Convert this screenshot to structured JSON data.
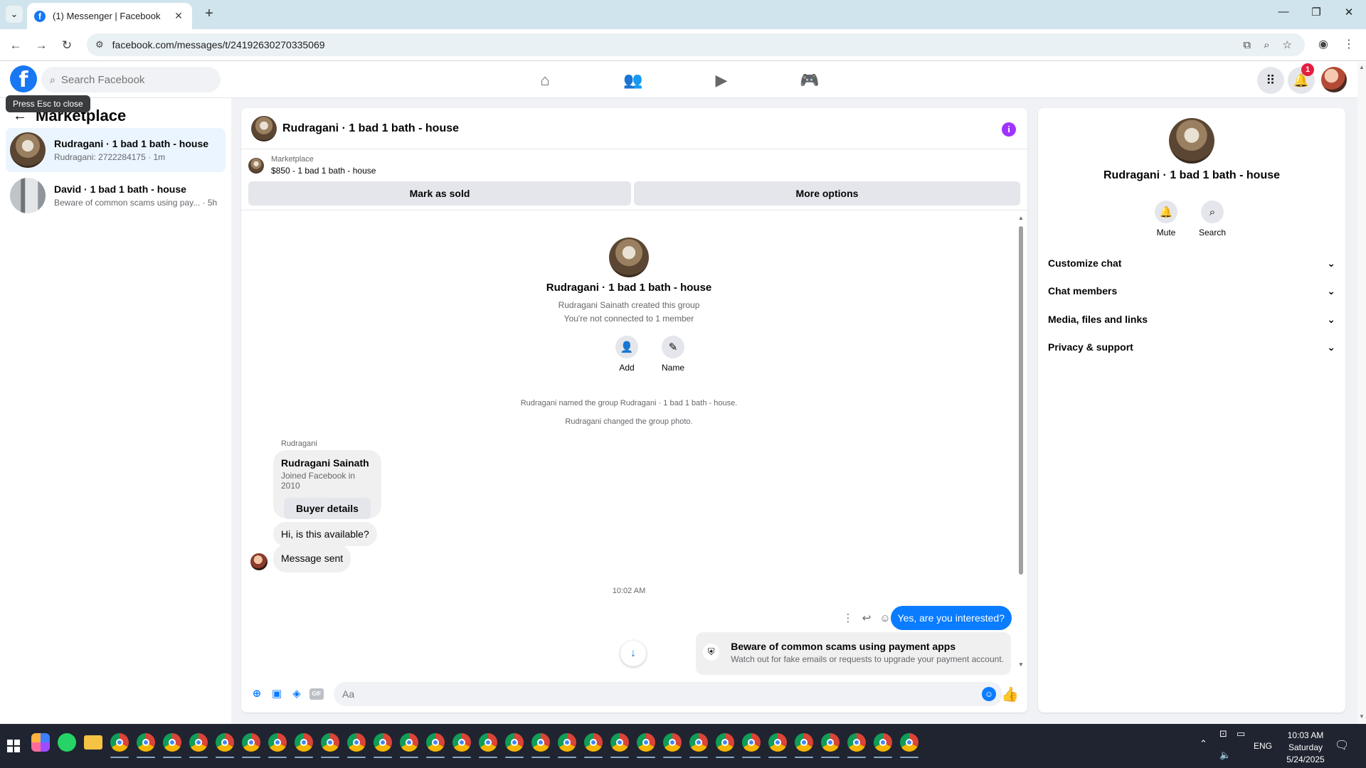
{
  "browser": {
    "tab_title": "(1) Messenger | Facebook",
    "favicon_letter": "f",
    "url": "facebook.com/messages/t/24192630270335069"
  },
  "fb": {
    "logo_letter": "f",
    "search_placeholder": "Search Facebook",
    "notification_count": "1"
  },
  "tooltip": "Press Esc to close",
  "left_panel": {
    "title": "Marketplace",
    "chats": [
      {
        "name": "Rudragani · 1 bad 1 bath - house",
        "preview": "Rudragani: 2722284175 · 1m"
      },
      {
        "name": "David · 1 bad 1 bath - house",
        "preview": "Beware of common scams using pay... · 5h"
      }
    ]
  },
  "conversation": {
    "title": "Rudragani · 1 bad 1 bath - house",
    "info_glyph": "i",
    "marketplace_label": "Marketplace",
    "listing": "$850 - 1 bad 1 bath - house",
    "mark_sold_label": "Mark as sold",
    "more_options_label": "More options",
    "group_name": "Rudragani · 1 bad 1 bath - house",
    "created_by": "Rudragani Sainath created this group",
    "not_connected": "You're not connected to 1 member",
    "add_label": "Add",
    "name_label": "Name",
    "sys_named": "Rudragani named the group Rudragani · 1 bad 1 bath - house.",
    "sys_photo": "Rudragani changed the group photo.",
    "sender": "Rudragani",
    "card_name": "Rudragani Sainath",
    "card_joined": "Joined Facebook in 2010",
    "buyer_details_label": "Buyer details",
    "msg_available": "Hi, is this available?",
    "msg_sent": "Message sent",
    "time": "10:02 AM",
    "my_reply": "Yes, are you interested?",
    "scam_title": "Beware of common scams using payment apps",
    "scam_sub": "Watch out for fake emails or requests to upgrade your payment account.",
    "composer_placeholder": "Aa",
    "gif_label": "GIF"
  },
  "right_panel": {
    "name": "Rudragani · 1 bad 1 bath - house",
    "mute_label": "Mute",
    "search_label": "Search",
    "sections": [
      "Customize chat",
      "Chat members",
      "Media, files and links",
      "Privacy & support"
    ]
  },
  "taskbar": {
    "language": "ENG",
    "time": "10:03 AM",
    "day": "Saturday",
    "date": "5/24/2025"
  }
}
